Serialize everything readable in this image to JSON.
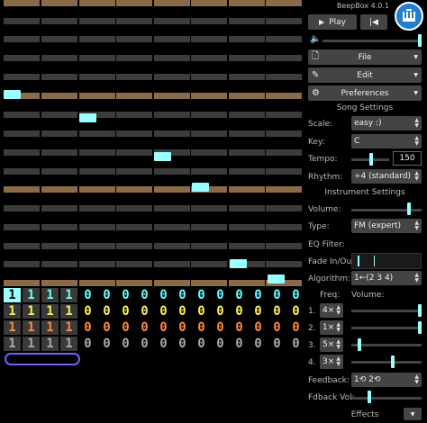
{
  "app": {
    "version": "BeepBox 4.0.1"
  },
  "toolbar": {
    "play_label": "Play",
    "file_label": "File",
    "edit_label": "Edit",
    "preferences_label": "Preferences"
  },
  "song_settings": {
    "heading": "Song Settings",
    "scale_label": "Scale:",
    "scale_value": "easy :)",
    "key_label": "Key:",
    "key_value": "C",
    "tempo_label": "Tempo:",
    "tempo_value": "150",
    "rhythm_label": "Rhythm:",
    "rhythm_value": "÷4 (standard)"
  },
  "instrument_settings": {
    "heading": "Instrument Settings",
    "volume_label": "Volume:",
    "type_label": "Type:",
    "type_value": "FM (expert)",
    "eq_label": "EQ Filter:",
    "fade_label": "Fade In/Out:",
    "algorithm_label": "Algorithm:",
    "algorithm_value": "1←(2 3 4)",
    "freq_header": "Freq:",
    "volume_header": "Volume:",
    "operators": [
      {
        "num": "1.",
        "freq": "4×",
        "level": 1.0
      },
      {
        "num": "2.",
        "freq": "1×",
        "level": 1.0
      },
      {
        "num": "3.",
        "freq": "5×",
        "level": 0.1
      },
      {
        "num": "4.",
        "freq": "3×",
        "level": 0.6
      }
    ],
    "feedback_label": "Feedback:",
    "feedback_value": "1⟲ 2⟲",
    "fdback_vol_label": "Fdback Vol:",
    "effects_label": "Effects"
  },
  "pattern_grid": {
    "channels": [
      {
        "color": "#66ffff",
        "cells": [
          "1",
          "1",
          "1",
          "1",
          "0",
          "0",
          "0",
          "0",
          "0",
          "0",
          "0",
          "0",
          "0",
          "0",
          "0",
          "0"
        ]
      },
      {
        "color": "#ffee55",
        "cells": [
          "1",
          "1",
          "1",
          "1",
          "0",
          "0",
          "0",
          "0",
          "0",
          "0",
          "0",
          "0",
          "0",
          "0",
          "0",
          "0"
        ]
      },
      {
        "color": "#ff8844",
        "cells": [
          "1",
          "1",
          "1",
          "1",
          "0",
          "0",
          "0",
          "0",
          "0",
          "0",
          "0",
          "0",
          "0",
          "0",
          "0",
          "0"
        ]
      },
      {
        "color": "#aaaaaa",
        "cells": [
          "1",
          "1",
          "1",
          "1",
          "0",
          "0",
          "0",
          "0",
          "0",
          "0",
          "0",
          "0",
          "0",
          "0",
          "0",
          "0"
        ]
      }
    ]
  },
  "colors": {
    "accent": "#99ffff",
    "octave_row": "#8b6a48",
    "row": "#3c3c3c",
    "panel_button": "#444444",
    "loop_outline": "#7c5cff"
  }
}
